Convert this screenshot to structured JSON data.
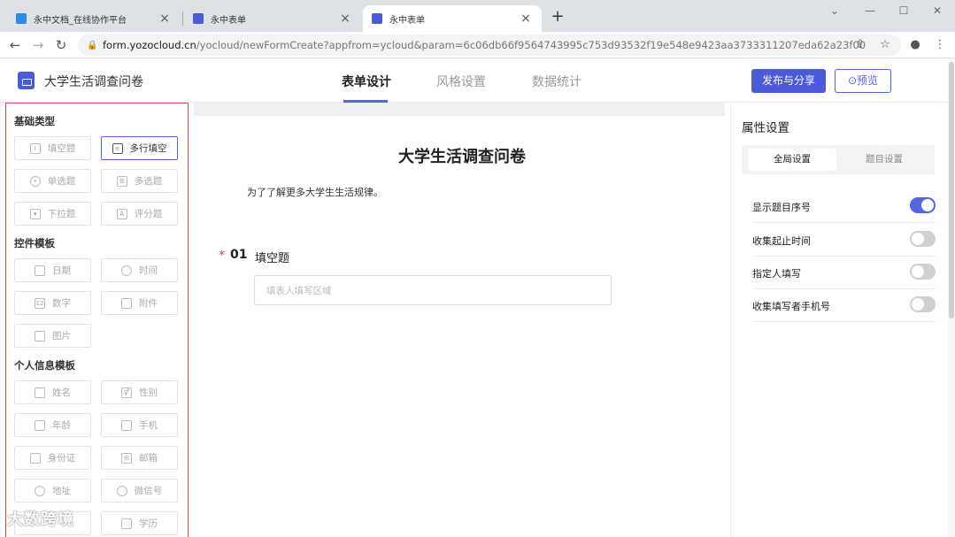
{
  "browser": {
    "tabs": [
      {
        "title": "永中文档_在线协作平台",
        "active": false,
        "favicon_color": "#2f8be6"
      },
      {
        "title": "永中表单",
        "active": false,
        "favicon_color": "#4b5bd8"
      },
      {
        "title": "永中表单",
        "active": true,
        "favicon_color": "#4b5bd8"
      }
    ],
    "url_host": "form.yozocloud.cn",
    "url_path": "/yocloud/newFormCreate?appfrom=ycloud&param=6c06db66f9564743995c753d93532f19e548e9423aa3733311207eda62a23f00"
  },
  "header": {
    "doc_title": "大学生活调查问卷",
    "tabs": [
      "表单设计",
      "风格设置",
      "数据统计"
    ],
    "active_tab": 0,
    "publish_label": "发布与分享",
    "preview_label": "⊙预览"
  },
  "left_panel": {
    "sections": [
      {
        "title": "基础类型",
        "items": [
          "填空题",
          "多行填空",
          "单选题",
          "多选题",
          "下拉题",
          "评分题"
        ]
      },
      {
        "title": "控件模板",
        "items": [
          "日期",
          "时间",
          "数字",
          "附件",
          "图片"
        ]
      },
      {
        "title": "个人信息模板",
        "items": [
          "姓名",
          "性别",
          "年龄",
          "手机",
          "身份证",
          "邮箱",
          "地址",
          "微信号",
          "",
          "学历"
        ]
      }
    ],
    "selected_item": "多行填空"
  },
  "form": {
    "title": "大学生活调查问卷",
    "description": "为了了解更多大学生生活规律。",
    "question": {
      "number": "01",
      "title": "填空题",
      "required_mark": "*",
      "placeholder": "填表人填写区域"
    }
  },
  "right_panel": {
    "title": "属性设置",
    "segments": [
      "全局设置",
      "题目设置"
    ],
    "active_segment": 0,
    "settings": [
      {
        "label": "显示题目序号",
        "on": true
      },
      {
        "label": "收集起止时间",
        "on": false
      },
      {
        "label": "指定人填写",
        "on": false
      },
      {
        "label": "收集填写者手机号",
        "on": false
      }
    ]
  },
  "watermark": "大数跨境",
  "colors": {
    "accent": "#5465e0",
    "panel_border": "#d24a4a"
  }
}
